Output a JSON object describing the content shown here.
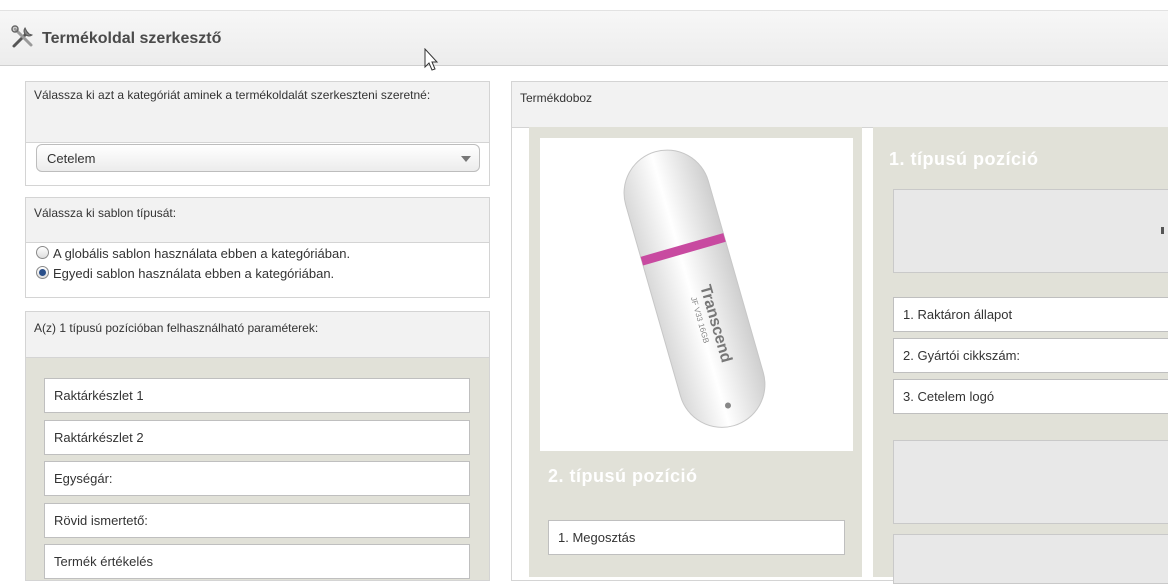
{
  "header": {
    "title": "Termékoldal szerkesztő",
    "icon": "tools-icon"
  },
  "category": {
    "heading": "Válassza ki azt a kategóriát aminek a termékoldalát szerkeszteni szeretné:",
    "selected": "Cetelem"
  },
  "template": {
    "heading": "Válassza ki sablon típusát:",
    "options": [
      {
        "label": "A globális sablon használata ebben a kategóriában.",
        "checked": false
      },
      {
        "label": "Egyedi sablon használata ebben a kategóriában.",
        "checked": true
      }
    ]
  },
  "params": {
    "heading": "A(z) 1 típusú pozícióban felhasználható paraméterek:",
    "items": [
      "Raktárkészlet 1",
      "Raktárkészlet 2",
      "Egységár:",
      "Rövid ismertető:",
      "Termék értékelés"
    ]
  },
  "productbox": {
    "heading": "Termékdoboz",
    "pos2": {
      "title": "2. típusú pozíció",
      "items": [
        "1. Megosztás"
      ]
    },
    "pos1": {
      "title": "1. típusú pozíció",
      "items": [
        "1. Raktáron állapot",
        "2. Gyártói cikkszám:",
        "3. Cetelem logó"
      ]
    },
    "usb_text": "Transcend",
    "usb_subtext": "JF V33 16GB"
  }
}
